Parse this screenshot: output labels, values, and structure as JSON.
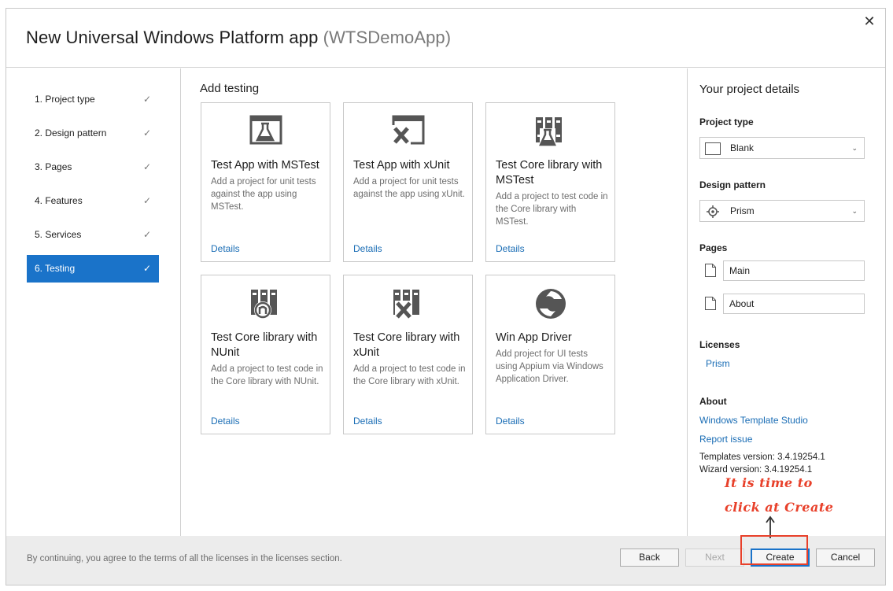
{
  "window": {
    "title": "New Universal Windows Platform app",
    "app_name": "(WTSDemoApp)",
    "close_glyph": "✕"
  },
  "steps": [
    {
      "label": "1. Project type",
      "done": true
    },
    {
      "label": "2. Design pattern",
      "done": true
    },
    {
      "label": "3. Pages",
      "done": true
    },
    {
      "label": "4. Features",
      "done": true
    },
    {
      "label": "5. Services",
      "done": true
    },
    {
      "label": "6. Testing",
      "done": true,
      "active": true
    }
  ],
  "check_glyph": "✓",
  "main": {
    "section_title": "Add testing",
    "cards": [
      {
        "title": "Test App with MSTest",
        "description": "Add a project for unit tests against the app using MSTest.",
        "link": "Details",
        "icon": "flask-app-icon"
      },
      {
        "title": "Test App with xUnit",
        "description": "Add a project for unit tests against the app using xUnit.",
        "link": "Details",
        "icon": "xunit-app-icon"
      },
      {
        "title": "Test Core library with MSTest",
        "description": "Add a project to test code in the Core library with MSTest.",
        "link": "Details",
        "icon": "library-flask-icon"
      },
      {
        "title": "Test Core library with NUnit",
        "description": "Add a project to test code in the Core library with NUnit.",
        "link": "Details",
        "icon": "library-nunit-icon"
      },
      {
        "title": "Test Core library with xUnit",
        "description": "Add a project to test code in the Core library with xUnit.",
        "link": "Details",
        "icon": "library-xunit-icon"
      },
      {
        "title": "Win App Driver",
        "description": "Add project for UI tests using Appium via Windows Application Driver.",
        "link": "Details",
        "icon": "appium-icon"
      }
    ]
  },
  "details": {
    "title": "Your project details",
    "project_type_label": "Project type",
    "project_type_value": "Blank",
    "design_pattern_label": "Design pattern",
    "design_pattern_value": "Prism",
    "pages_label": "Pages",
    "pages": [
      "Main",
      "About"
    ],
    "licenses_label": "Licenses",
    "license_link": "Prism",
    "about_label": "About",
    "about_link": "Windows Template Studio",
    "report_link": "Report issue",
    "templates_version": "Templates version: 3.4.19254.1",
    "wizard_version": "Wizard version: 3.4.19254.1"
  },
  "annotation": {
    "line1": "It is time to",
    "line2": "click at Create",
    "color": "#e8402a"
  },
  "footer": {
    "note": "By continuing, you agree to the terms of all the licenses in the licenses section.",
    "back": "Back",
    "next": "Next",
    "create": "Create",
    "cancel": "Cancel"
  },
  "colors": {
    "accent": "#1a73c9",
    "link": "#1a6db5"
  }
}
